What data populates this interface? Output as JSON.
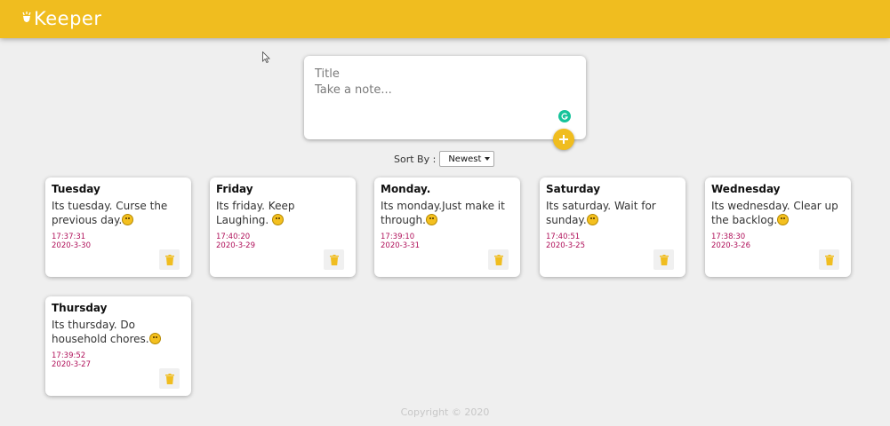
{
  "app": {
    "title": "Keeper"
  },
  "composer": {
    "title_placeholder": "Title",
    "body_placeholder": "Take a note...",
    "add_icon": "plus-icon"
  },
  "sort": {
    "label": "Sort By :",
    "selected": "Newest"
  },
  "notes": [
    {
      "title": "Tuesday",
      "body": "Its tuesday. Curse the previous day.",
      "time": "17:37:31",
      "date": "2020-3-30"
    },
    {
      "title": "Friday",
      "body": "Its friday. Keep Laughing.",
      "time": "17:40:20",
      "date": "2020-3-29"
    },
    {
      "title": "Monday.",
      "body": "Its monday.Just make it through.",
      "time": "17:39:10",
      "date": "2020-3-31"
    },
    {
      "title": "Saturday",
      "body": "Its saturday. Wait for sunday.",
      "time": "17:40:51",
      "date": "2020-3-25"
    },
    {
      "title": "Wednesday",
      "body": "Its wednesday. Clear up the backlog.",
      "time": "17:38:30",
      "date": "2020-3-26"
    },
    {
      "title": "Thursday",
      "body": "Its thursday. Do household chores.",
      "time": "17:39:52",
      "date": "2020-3-27"
    }
  ],
  "footer": {
    "text": "Copyright © 2020"
  },
  "colors": {
    "accent": "#f0bd1f",
    "timestamp": "#b0105a",
    "background": "#efefef"
  }
}
